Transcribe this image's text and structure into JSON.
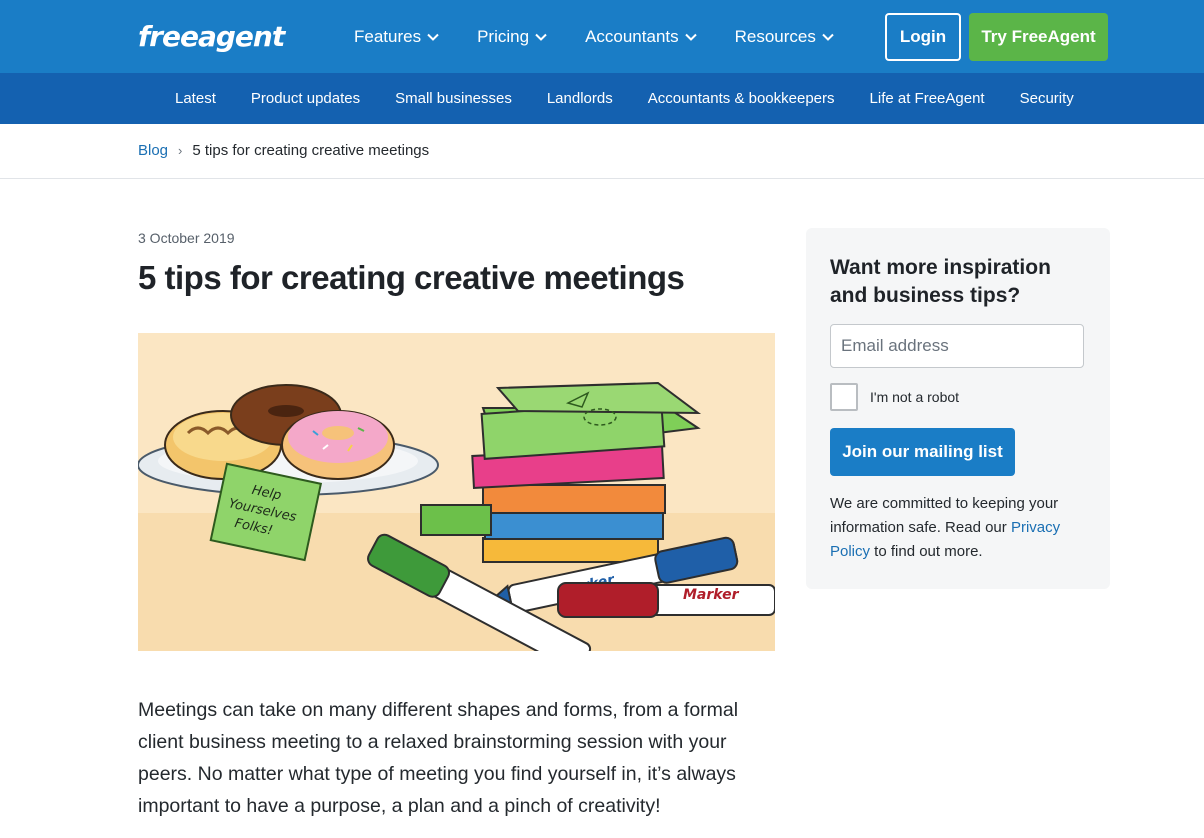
{
  "brand": {
    "logo_text": "FreeAgent",
    "primary_blue": "#1a7dc6",
    "subnav_blue": "#1461b0",
    "cta_green": "#5bb548"
  },
  "header": {
    "nav": [
      {
        "label": "Features"
      },
      {
        "label": "Pricing"
      },
      {
        "label": "Accountants"
      },
      {
        "label": "Resources"
      }
    ],
    "login_label": "Login",
    "cta_label": "Try FreeAgent"
  },
  "subnav": {
    "items": [
      {
        "label": "Latest"
      },
      {
        "label": "Product updates"
      },
      {
        "label": "Small businesses"
      },
      {
        "label": "Landlords"
      },
      {
        "label": "Accountants & bookkeepers"
      },
      {
        "label": "Life at FreeAgent"
      },
      {
        "label": "Security"
      }
    ]
  },
  "breadcrumb": {
    "root": "Blog",
    "separator": "›",
    "current": "5 tips for creating creative meetings"
  },
  "article": {
    "date": "3 October 2019",
    "title": "5 tips for creating creative meetings",
    "hero": {
      "sticky_note_lines": [
        "Help",
        "Yourselves",
        "Folks!"
      ],
      "blue_marker_label": "Marker",
      "red_marker_label": "Marker"
    },
    "intro": "Meetings can take on many different shapes and forms, from a formal client business meeting to a relaxed brainstorming session with your peers. No matter what type of meeting you find yourself in, it’s always important to have a purpose, a plan and a pinch of creativity!"
  },
  "sidebar": {
    "heading": "Want more inspiration and business tips?",
    "email_placeholder": "Email address",
    "captcha_label": "I'm not a robot",
    "join_label": "Join our mailing list",
    "note_before": "We are committed to keeping your information safe. Read our ",
    "note_link": "Privacy Policy",
    "note_after": " to find out more."
  }
}
